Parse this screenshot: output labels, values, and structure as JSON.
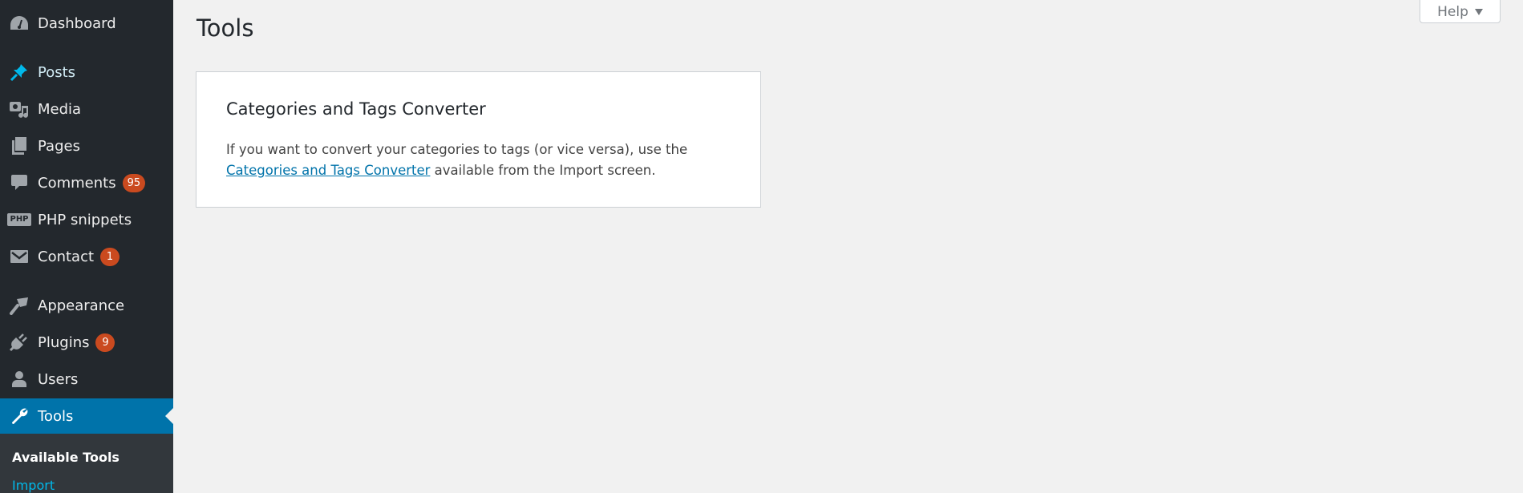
{
  "page": {
    "title": "Tools"
  },
  "help": {
    "label": "Help"
  },
  "sidebar": {
    "items": [
      {
        "label": "Dashboard",
        "icon": "dashboard-icon"
      },
      {
        "label": "Posts",
        "icon": "pin-icon"
      },
      {
        "label": "Media",
        "icon": "media-icon"
      },
      {
        "label": "Pages",
        "icon": "pages-icon"
      },
      {
        "label": "Comments",
        "icon": "comment-icon",
        "badge": "95"
      },
      {
        "label": "PHP snippets",
        "icon": "php-icon",
        "icon_text": "PHP"
      },
      {
        "label": "Contact",
        "icon": "mail-icon",
        "badge": "1"
      },
      {
        "label": "Appearance",
        "icon": "paintbrush-icon"
      },
      {
        "label": "Plugins",
        "icon": "plugin-icon",
        "badge": "9"
      },
      {
        "label": "Users",
        "icon": "user-icon"
      },
      {
        "label": "Tools",
        "icon": "wrench-icon",
        "active": true
      }
    ],
    "submenu": {
      "heading": "Available Tools",
      "items": [
        {
          "label": "Import"
        }
      ]
    }
  },
  "card": {
    "title": "Categories and Tags Converter",
    "text_before": "If you want to convert your categories to tags (or vice versa), use the ",
    "link": "Categories and Tags Converter",
    "text_after": " available from the Import screen."
  },
  "colors": {
    "sidebar_bg": "#23282d",
    "active_bg": "#0073aa",
    "badge_bg": "#ca4a1f",
    "link": "#0073aa"
  }
}
